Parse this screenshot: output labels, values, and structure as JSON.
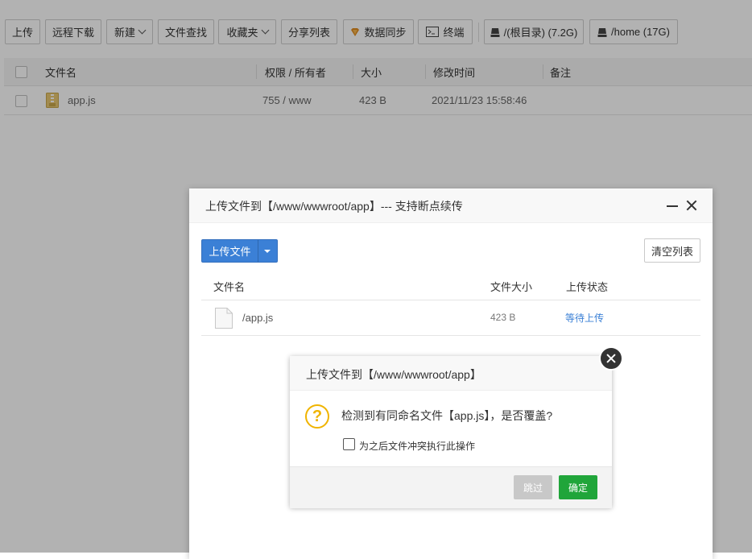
{
  "toolbar": {
    "buttons": [
      {
        "label": "上传"
      },
      {
        "label": "远程下载"
      },
      {
        "label": "新建"
      },
      {
        "label": "文件查找"
      },
      {
        "label": "收藏夹"
      },
      {
        "label": "分享列表"
      },
      {
        "label": "数据同步"
      },
      {
        "label": "终端"
      }
    ],
    "disks": [
      {
        "label": "/(根目录) (7.2G)"
      },
      {
        "label": "/home (17G)"
      }
    ]
  },
  "file_table": {
    "headers": [
      "文件名",
      "权限 / 所有者",
      "大小",
      "修改时间",
      "备注"
    ],
    "rows": [
      {
        "name": "app.js",
        "permission": "755 / www",
        "size": "423 B",
        "modified": "2021/11/23 15:58:46"
      }
    ]
  },
  "upload_dialog": {
    "title": "上传文件到【/www/wwwroot/app】--- 支持断点续传",
    "upload_button": "上传文件",
    "clear_button": "清空列表",
    "headers": [
      "文件名",
      "文件大小",
      "上传状态"
    ],
    "rows": [
      {
        "name": "/app.js",
        "size": "423 B",
        "status": "等待上传"
      }
    ]
  },
  "confirm_dialog": {
    "title": "上传文件到【/www/wwwroot/app】",
    "message": "检测到有同命名文件【app.js】，是否覆盖?",
    "checkbox_label": "为之后文件冲突执行此操作",
    "skip_button": "跳过",
    "ok_button": "确定"
  },
  "colors": {
    "primary_blue": "#3b80d6",
    "success_green": "#20a53a",
    "link_blue": "#3b80d6",
    "warning_yellow": "#f0b400"
  },
  "icons": [
    "chevron-down-icon",
    "sync-icon",
    "terminal-icon",
    "disk-icon",
    "js-file-icon",
    "file-icon",
    "minimize-icon",
    "close-icon",
    "question-icon"
  ]
}
